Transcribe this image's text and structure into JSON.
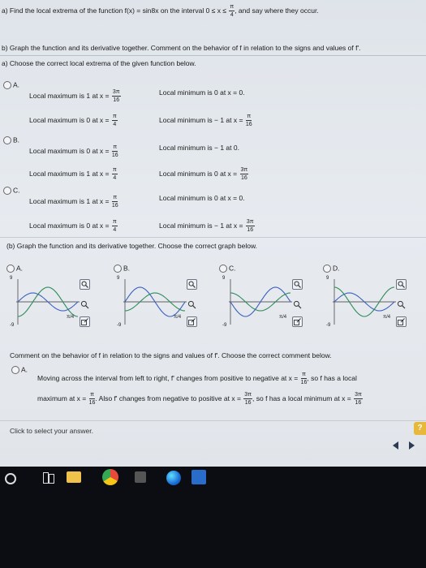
{
  "question": {
    "part_a_prefix": "a) Find the local extrema of the function f(x) = sin8x on the interval 0 ≤ x ≤",
    "part_a_bound": {
      "num": "π",
      "den": "4"
    },
    "part_a_suffix": ", and say where they occur.",
    "part_b": "b) Graph the function and its derivative together. Comment on the behavior of f in relation to the signs and values of f'.",
    "instruction_a": "a) Choose the correct local extrema of the given function below."
  },
  "options_a": [
    {
      "letter": "A.",
      "rows": [
        {
          "left": "Local maximum is 1 at x =",
          "lnum": "3π",
          "lden": "16",
          "right": "Local minimum is 0 at x = 0.",
          "rnum": "",
          "rden": ""
        },
        {
          "left": "Local maximum is 0 at x =",
          "lnum": "π",
          "lden": "4",
          "right": "Local minimum is − 1 at x =",
          "rnum": "π",
          "rden": "16"
        }
      ]
    },
    {
      "letter": "B.",
      "rows": [
        {
          "left": "Local maximum is 0 at x =",
          "lnum": "π",
          "lden": "16",
          "right": "Local minimum is − 1 at 0.",
          "rnum": "",
          "rden": ""
        },
        {
          "left": "Local maximum is 1 at x =",
          "lnum": "π",
          "lden": "4",
          "right": "Local minimum is 0 at x =",
          "rnum": "3π",
          "rden": "16"
        }
      ]
    },
    {
      "letter": "C.",
      "rows": [
        {
          "left": "Local maximum is 1 at x =",
          "lnum": "π",
          "lden": "16",
          "right": "Local minimum is 0 at x = 0.",
          "rnum": "",
          "rden": ""
        },
        {
          "left": "Local maximum is 0 at x =",
          "lnum": "π",
          "lden": "4",
          "right": "Local minimum is − 1 at x =",
          "rnum": "3π",
          "rden": "16"
        }
      ]
    }
  ],
  "part_b_instruction": "(b) Graph the function and its derivative together. Choose the correct graph below.",
  "graph_options": [
    {
      "letter": "A.",
      "ymax": "9",
      "ymin": "-9",
      "xtick": "π/4"
    },
    {
      "letter": "B.",
      "ymax": "9",
      "ymin": "-9",
      "xtick": "π/4"
    },
    {
      "letter": "C.",
      "ymax": "9",
      "ymin": "-9",
      "xtick": "π/4"
    },
    {
      "letter": "D.",
      "ymax": "9",
      "ymin": "-9",
      "xtick": "π/4"
    }
  ],
  "comment_instruction": "Comment on the behavior of f in relation to the signs and values of f'. Choose the correct comment below.",
  "comment_a": {
    "letter": "A.",
    "line1_prefix": "Moving across the interval from left to right, f' changes from positive to negative at x =",
    "line1_frac": {
      "num": "π",
      "den": "16"
    },
    "line1_suffix": ", so f has a local",
    "line2_prefix": "maximum at x =",
    "line2_frac": {
      "num": "π",
      "den": "16"
    },
    "line2_mid": ". Also f' changes from negative to positive at x =",
    "line2_frac2": {
      "num": "3π",
      "den": "16"
    },
    "line2_mid2": ", so f has a local minimum at x =",
    "line2_frac3": {
      "num": "3π",
      "den": "16"
    }
  },
  "footer": {
    "hint": "Click to select your answer.",
    "help": "?"
  },
  "colors": {
    "accent_blue": "#3a66b0",
    "f_curve": "#3a5fc0",
    "fprime_curve": "#2e8b57"
  }
}
